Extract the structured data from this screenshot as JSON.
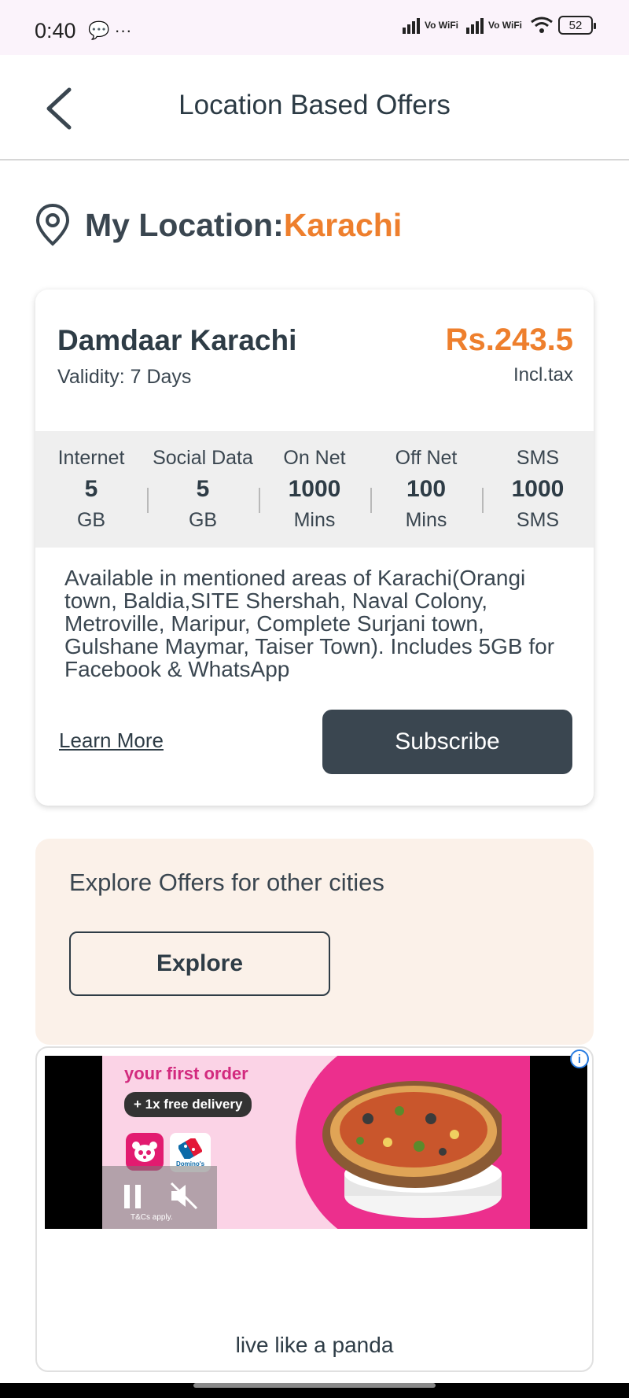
{
  "status_bar": {
    "time": "0:40",
    "left_icons": "💬 ···",
    "network_label_1": "Vo WiFi",
    "network_label_2": "Vo WiFi",
    "battery": "52"
  },
  "header": {
    "title": "Location Based Offers"
  },
  "location": {
    "label": "My Location:",
    "city": "Karachi"
  },
  "offer": {
    "name": "Damdaar Karachi",
    "validity": "Validity: 7 Days",
    "price": "Rs.243.5",
    "tax_note": "Incl.tax",
    "stats": [
      {
        "label": "Internet",
        "value": "5",
        "unit": "GB"
      },
      {
        "label": "Social Data",
        "value": "5",
        "unit": "GB"
      },
      {
        "label": "On Net",
        "value": "1000",
        "unit": "Mins"
      },
      {
        "label": "Off Net",
        "value": "100",
        "unit": "Mins"
      },
      {
        "label": "SMS",
        "value": "1000",
        "unit": "SMS"
      }
    ],
    "description": "Available in mentioned areas of Karachi(Orangi town, Baldia,SITE Shershah, Naval Colony, Metroville, Maripur, Complete Surjani town, Gulshane Maymar, Taiser Town). Includes 5GB for Facebook & WhatsApp",
    "learn_more_label": "Learn More",
    "subscribe_label": "Subscribe"
  },
  "explore": {
    "text": "Explore Offers for other cities",
    "button_label": "Explore"
  },
  "ad": {
    "headline": "your first order",
    "pill": "+ 1x free delivery",
    "dominos_label": "Domino's",
    "terms": "T&Cs apply.",
    "info_icon": "i",
    "tagline": "live like a panda"
  },
  "colors": {
    "accent_orange": "#ee7f2d",
    "dark_slate": "#3a4650",
    "explore_bg": "#fbf1e9",
    "ad_pink": "#ec2f8d"
  }
}
